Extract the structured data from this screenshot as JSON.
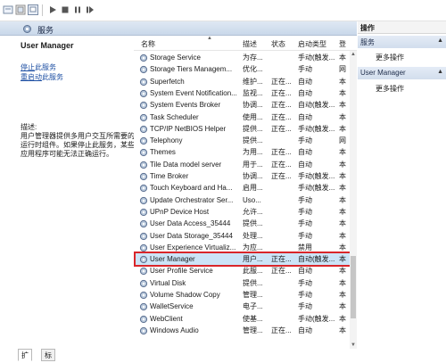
{
  "toolbar": {
    "buttons": [
      "back-icon",
      "up-icon",
      "help-icon",
      "play-icon",
      "stop-icon",
      "pause-icon",
      "restart-icon"
    ]
  },
  "header": {
    "title": "服务"
  },
  "detail": {
    "title": "User Manager",
    "stop_link": "停止",
    "stop_suffix": "此服务",
    "restart_link": "重启动",
    "restart_suffix": "此服务",
    "desc_label": "描述:",
    "desc_text": "用户管理器提供多用户交互所需要的运行时组件。如果停止此服务，某些应用程序可能无法正确运行。"
  },
  "columns": {
    "name": "名称",
    "desc": "描述",
    "status": "状态",
    "startup": "启动类型",
    "logon": "登"
  },
  "services": [
    {
      "name": "Storage Service",
      "desc": "为存...",
      "status": "",
      "startup": "手动(触发...",
      "logon": "本"
    },
    {
      "name": "Storage Tiers Managem...",
      "desc": "优化...",
      "status": "",
      "startup": "手动",
      "logon": "网"
    },
    {
      "name": "Superfetch",
      "desc": "维护...",
      "status": "正在...",
      "startup": "自动",
      "logon": "本"
    },
    {
      "name": "System Event Notification...",
      "desc": "监视...",
      "status": "正在...",
      "startup": "自动",
      "logon": "本"
    },
    {
      "name": "System Events Broker",
      "desc": "协调...",
      "status": "正在...",
      "startup": "自动(触发...",
      "logon": "本"
    },
    {
      "name": "Task Scheduler",
      "desc": "使用...",
      "status": "正在...",
      "startup": "自动",
      "logon": "本"
    },
    {
      "name": "TCP/IP NetBIOS Helper",
      "desc": "提供...",
      "status": "正在...",
      "startup": "手动(触发...",
      "logon": "本"
    },
    {
      "name": "Telephony",
      "desc": "提供...",
      "status": "",
      "startup": "手动",
      "logon": "网"
    },
    {
      "name": "Themes",
      "desc": "为用...",
      "status": "正在...",
      "startup": "自动",
      "logon": "本"
    },
    {
      "name": "Tile Data model server",
      "desc": "用于...",
      "status": "正在...",
      "startup": "自动",
      "logon": "本"
    },
    {
      "name": "Time Broker",
      "desc": "协调...",
      "status": "正在...",
      "startup": "手动(触发...",
      "logon": "本"
    },
    {
      "name": "Touch Keyboard and Ha...",
      "desc": "启用...",
      "status": "",
      "startup": "手动(触发...",
      "logon": "本"
    },
    {
      "name": "Update Orchestrator Ser...",
      "desc": "Uso...",
      "status": "",
      "startup": "手动",
      "logon": "本"
    },
    {
      "name": "UPnP Device Host",
      "desc": "允许...",
      "status": "",
      "startup": "手动",
      "logon": "本"
    },
    {
      "name": "User Data Access_35444",
      "desc": "提供...",
      "status": "",
      "startup": "手动",
      "logon": "本"
    },
    {
      "name": "User Data Storage_35444",
      "desc": "处理...",
      "status": "",
      "startup": "手动",
      "logon": "本"
    },
    {
      "name": "User Experience Virtualiz...",
      "desc": "为应...",
      "status": "",
      "startup": "禁用",
      "logon": "本"
    },
    {
      "name": "User Manager",
      "desc": "用户...",
      "status": "正在...",
      "startup": "自动(触发...",
      "logon": "本"
    },
    {
      "name": "User Profile Service",
      "desc": "此服...",
      "status": "正在...",
      "startup": "自动",
      "logon": "本"
    },
    {
      "name": "Virtual Disk",
      "desc": "提供...",
      "status": "",
      "startup": "手动",
      "logon": "本"
    },
    {
      "name": "Volume Shadow Copy",
      "desc": "管理...",
      "status": "",
      "startup": "手动",
      "logon": "本"
    },
    {
      "name": "WalletService",
      "desc": "电子...",
      "status": "",
      "startup": "手动",
      "logon": "本"
    },
    {
      "name": "WebClient",
      "desc": "使基...",
      "status": "",
      "startup": "手动(触发...",
      "logon": "本"
    },
    {
      "name": "Windows Audio",
      "desc": "管理...",
      "status": "正在...",
      "startup": "自动",
      "logon": "本"
    }
  ],
  "selected_index": 17,
  "tabs": [
    "扩展",
    "标准"
  ],
  "actions": {
    "header": "操作",
    "section1": "服务",
    "section1_item": "更多操作",
    "section2": "User Manager",
    "section2_item": "更多操作"
  },
  "colors": {
    "selection": "#cce4f7",
    "highlight_border": "#d9262a",
    "link": "#1d4fa3"
  }
}
